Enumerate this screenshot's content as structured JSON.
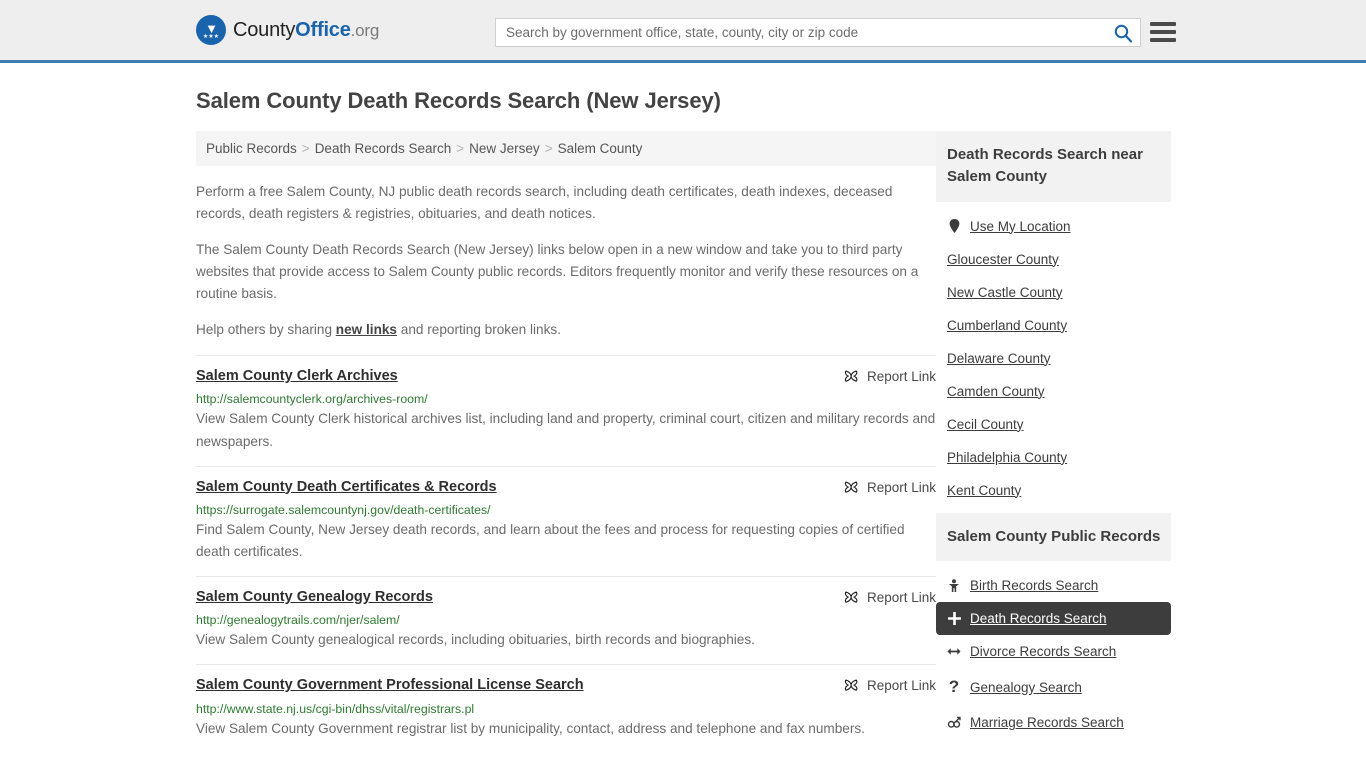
{
  "header": {
    "brand": {
      "part1": "County",
      "part2": "Office",
      "part3": ".org"
    },
    "search": {
      "placeholder": "Search by government office, state, county, city or zip code",
      "value": "",
      "search_icon": "search-icon"
    },
    "menu_icon": "hamburger-menu-icon"
  },
  "page_title": "Salem County Death Records Search (New Jersey)",
  "breadcrumb": {
    "items": [
      "Public Records",
      "Death Records Search",
      "New Jersey",
      "Salem County"
    ],
    "separator": ">"
  },
  "intro": {
    "p1": "Perform a free Salem County, NJ public death records search, including death certificates, death indexes, deceased records, death registers & registries, obituaries, and death notices.",
    "p2": "The Salem County Death Records Search (New Jersey) links below open in a new window and take you to third party websites that provide access to Salem County public records. Editors frequently monitor and verify these resources on a routine basis.",
    "p3_before": "Help others by sharing ",
    "p3_link": "new links",
    "p3_after": " and reporting broken links."
  },
  "results": {
    "report_label": "Report Link",
    "report_icon": "broken-link-icon",
    "items": [
      {
        "title": "Salem County Clerk Archives",
        "url": "http://salemcountyclerk.org/archives-room/",
        "description": "View Salem County Clerk historical archives list, including land and property, criminal court, citizen and military records and newspapers."
      },
      {
        "title": "Salem County Death Certificates & Records",
        "url": "https://surrogate.salemcountynj.gov/death-certificates/",
        "description": "Find Salem County, New Jersey death records, and learn about the fees and process for requesting copies of certified death certificates."
      },
      {
        "title": "Salem County Genealogy Records",
        "url": "http://genealogytrails.com/njer/salem/",
        "description": "View Salem County genealogical records, including obituaries, birth records and biographies."
      },
      {
        "title": "Salem County Government Professional License Search",
        "url": "http://www.state.nj.us/cgi-bin/dhss/vital/registrars.pl",
        "description": "View Salem County Government registrar list by municipality, contact, address and telephone and fax numbers."
      }
    ]
  },
  "sidebar": {
    "nearby": {
      "title": "Death Records Search near Salem County",
      "items": [
        {
          "label": "Use My Location",
          "icon": "location-pin-icon",
          "glyph": "•",
          "active": false
        },
        {
          "label": "Gloucester County",
          "icon": "",
          "glyph": "",
          "active": false
        },
        {
          "label": "New Castle County",
          "icon": "",
          "glyph": "",
          "active": false
        },
        {
          "label": "Cumberland County",
          "icon": "",
          "glyph": "",
          "active": false
        },
        {
          "label": "Delaware County",
          "icon": "",
          "glyph": "",
          "active": false
        },
        {
          "label": "Camden County",
          "icon": "",
          "glyph": "",
          "active": false
        },
        {
          "label": "Cecil County",
          "icon": "",
          "glyph": "",
          "active": false
        },
        {
          "label": "Philadelphia County",
          "icon": "",
          "glyph": "",
          "active": false
        },
        {
          "label": "Kent County",
          "icon": "",
          "glyph": "",
          "active": false
        }
      ]
    },
    "public_records": {
      "title": "Salem County Public Records",
      "items": [
        {
          "label": "Birth Records Search",
          "icon": "baby-icon",
          "glyph": "Ɣ",
          "active": false
        },
        {
          "label": "Death Records Search",
          "icon": "cross-icon",
          "glyph": "✚",
          "active": true
        },
        {
          "label": "Divorce Records Search",
          "icon": "left-right-arrow-icon",
          "glyph": "↔",
          "active": false
        },
        {
          "label": "Genealogy Search",
          "icon": "question-mark-icon",
          "glyph": "?",
          "active": false
        },
        {
          "label": "Marriage Records Search",
          "icon": "male-female-icon",
          "glyph": "⚥",
          "active": false
        }
      ]
    }
  },
  "colors": {
    "brand_blue": "#1a63ad",
    "header_rule": "#3f7aad",
    "url_green": "#2f7a32",
    "active_bg": "#3d3d3d",
    "panel_bg": "#f2f2f2"
  }
}
